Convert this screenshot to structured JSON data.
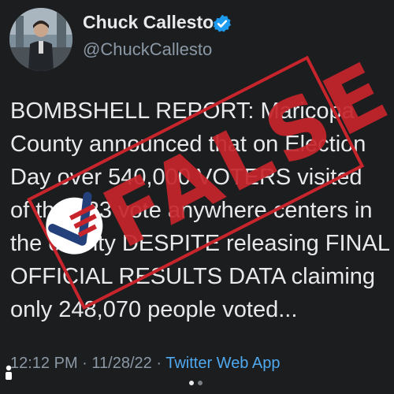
{
  "user": {
    "display_name": "Chuck Callesto",
    "handle": "@ChuckCallesto",
    "verified": true
  },
  "tweet": {
    "lines": [
      "BOMBSHELL REPORT: Maricopa",
      "County announced that on Election",
      "Day over 540,000 VOTERS visited",
      "of the 223 vote anywhere centers in",
      "the county DESPITE releasing FINAL",
      "OFFICIAL RESULTS DATA claiming",
      "only 248,070 people voted..."
    ],
    "time": "12:12 PM",
    "separator1": "·",
    "date": "11/28/22",
    "separator2": "·",
    "source": "Twitter Web App"
  },
  "stamp": {
    "text": "FALSE",
    "color": "#c7242c"
  },
  "pagination": {
    "count": 2,
    "active_index": 0
  },
  "colors": {
    "background": "#1c1d1f",
    "text": "#e7e9ea",
    "muted": "#8b98a5",
    "link": "#4fa9f0",
    "verified": "#1d9bf0"
  }
}
